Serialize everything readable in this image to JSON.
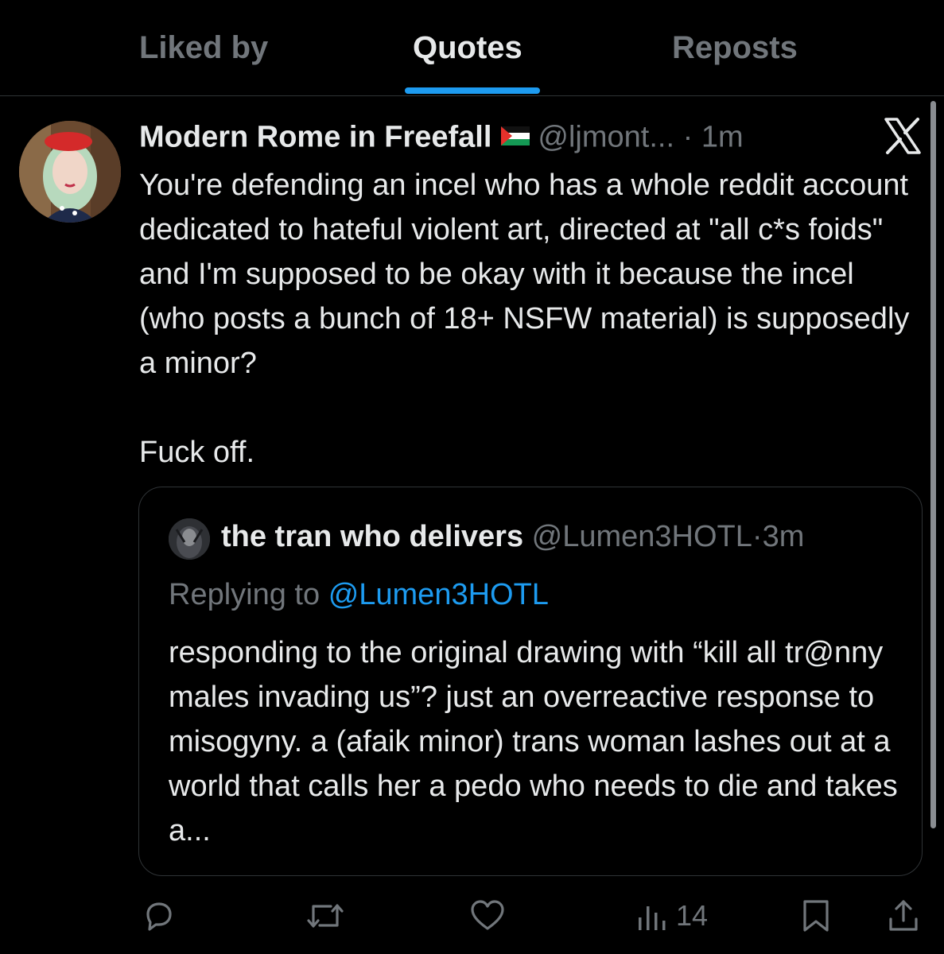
{
  "tabs": [
    {
      "label": "Liked by",
      "active": false
    },
    {
      "label": "Quotes",
      "active": true
    },
    {
      "label": "Reposts",
      "active": false
    }
  ],
  "post": {
    "author_name": "Modern Rome in Freefall",
    "flag_icon": "palestine-flag-icon",
    "handle": "@ljmont...",
    "separator": "·",
    "time": "1m",
    "text": "You're defending an incel who has a whole reddit account dedicated to hateful violent art, directed at \"all c*s foids\" and I'm supposed to be okay with it because the incel (who posts a bunch of 18+ NSFW material) is supposedly a minor?\n\nFuck off."
  },
  "quoted_post": {
    "author_name": "the tran who delivers",
    "handle": "@Lumen3HOTL",
    "separator": "·",
    "time": "3m",
    "replying_prefix": "Replying to",
    "replying_mention": "@Lumen3HOTL",
    "text": "responding to the original drawing with “kill all tr@nny males invading us”? just an overreactive response to misogyny. a (afaik minor) trans woman lashes out at a world that calls her a pedo who needs to die and takes a..."
  },
  "actions": {
    "views_count": "14"
  },
  "colors": {
    "background": "#000000",
    "text_primary": "#e7e9ea",
    "text_secondary": "#71767b",
    "accent": "#1d9bf0",
    "border": "#2f3336"
  }
}
